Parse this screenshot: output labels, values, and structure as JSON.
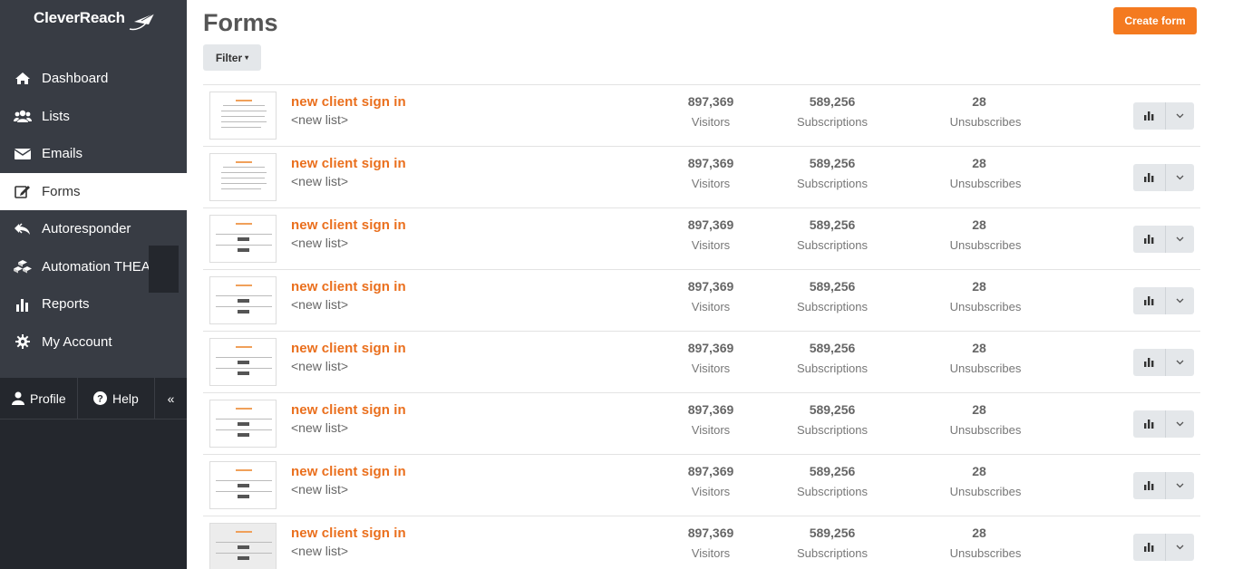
{
  "brand": {
    "name": "CleverReach"
  },
  "sidebar": {
    "items": [
      {
        "label": "Dashboard",
        "icon": "home-icon"
      },
      {
        "label": "Lists",
        "icon": "users-icon"
      },
      {
        "label": "Emails",
        "icon": "envelope-icon"
      },
      {
        "label": "Forms",
        "icon": "edit-icon",
        "active": true
      },
      {
        "label": "Autoresponder",
        "icon": "reply-all-icon"
      },
      {
        "label": "Automation THEA",
        "icon": "cubes-icon"
      },
      {
        "label": "Reports",
        "icon": "bar-chart-icon"
      },
      {
        "label": "My Account",
        "icon": "gear-icon"
      }
    ],
    "bottom": {
      "profile": "Profile",
      "help": "Help",
      "collapse": "«"
    }
  },
  "header": {
    "title": "Forms",
    "create_label": "Create form",
    "filter_label": "Filter",
    "filter_caret": "▾"
  },
  "colors": {
    "accent": "#f47a20",
    "sidebar": "#383c44",
    "sidebar_dark": "#24272d",
    "link": "#ea6f1d"
  },
  "forms": [
    {
      "name": "new client sign in",
      "list": "<new list>",
      "visitors": "897,369",
      "visitors_label": "Visitors",
      "subscriptions": "589,256",
      "subscriptions_label": "Subscriptions",
      "unsubscribes": "28",
      "unsubscribes_label": "Unsubscribes"
    },
    {
      "name": "new client sign in",
      "list": "<new list>",
      "visitors": "897,369",
      "visitors_label": "Visitors",
      "subscriptions": "589,256",
      "subscriptions_label": "Subscriptions",
      "unsubscribes": "28",
      "unsubscribes_label": "Unsubscribes"
    },
    {
      "name": "new client sign in",
      "list": "<new list>",
      "visitors": "897,369",
      "visitors_label": "Visitors",
      "subscriptions": "589,256",
      "subscriptions_label": "Subscriptions",
      "unsubscribes": "28",
      "unsubscribes_label": "Unsubscribes"
    },
    {
      "name": "new client sign in",
      "list": "<new list>",
      "visitors": "897,369",
      "visitors_label": "Visitors",
      "subscriptions": "589,256",
      "subscriptions_label": "Subscriptions",
      "unsubscribes": "28",
      "unsubscribes_label": "Unsubscribes"
    },
    {
      "name": "new client sign in",
      "list": "<new list>",
      "visitors": "897,369",
      "visitors_label": "Visitors",
      "subscriptions": "589,256",
      "subscriptions_label": "Subscriptions",
      "unsubscribes": "28",
      "unsubscribes_label": "Unsubscribes"
    },
    {
      "name": "new client sign in",
      "list": "<new list>",
      "visitors": "897,369",
      "visitors_label": "Visitors",
      "subscriptions": "589,256",
      "subscriptions_label": "Subscriptions",
      "unsubscribes": "28",
      "unsubscribes_label": "Unsubscribes"
    },
    {
      "name": "new client sign in",
      "list": "<new list>",
      "visitors": "897,369",
      "visitors_label": "Visitors",
      "subscriptions": "589,256",
      "subscriptions_label": "Subscriptions",
      "unsubscribes": "28",
      "unsubscribes_label": "Unsubscribes"
    },
    {
      "name": "new client sign in",
      "list": "<new list>",
      "visitors": "897,369",
      "visitors_label": "Visitors",
      "subscriptions": "589,256",
      "subscriptions_label": "Subscriptions",
      "unsubscribes": "28",
      "unsubscribes_label": "Unsubscribes"
    }
  ]
}
